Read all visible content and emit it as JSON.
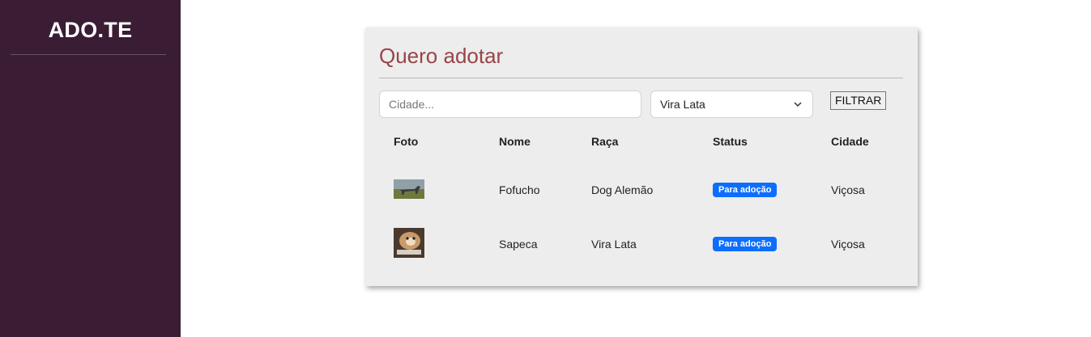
{
  "sidebar": {
    "brand": "ADO.TE"
  },
  "card": {
    "title": "Quero adotar",
    "filters": {
      "city_placeholder": "Cidade...",
      "city_value": "",
      "breed_selected": "Vira Lata",
      "filter_button": "FILTRAR"
    },
    "table": {
      "headers": [
        "Foto",
        "Nome",
        "Raça",
        "Status",
        "Cidade"
      ],
      "rows": [
        {
          "photo": "dog-photo",
          "name": "Fofucho",
          "breed": "Dog Alemão",
          "status": "Para adoção",
          "city": "Viçosa"
        },
        {
          "photo": "dog-photo",
          "name": "Sapeca",
          "breed": "Vira Lata",
          "status": "Para adoção",
          "city": "Viçosa"
        }
      ]
    }
  },
  "colors": {
    "sidebar_bg": "#3a1c34",
    "title": "#9a4448",
    "badge": "#0d6efd",
    "card_bg": "#ededed"
  },
  "icons": {
    "select_caret": "chevron-down-icon"
  }
}
